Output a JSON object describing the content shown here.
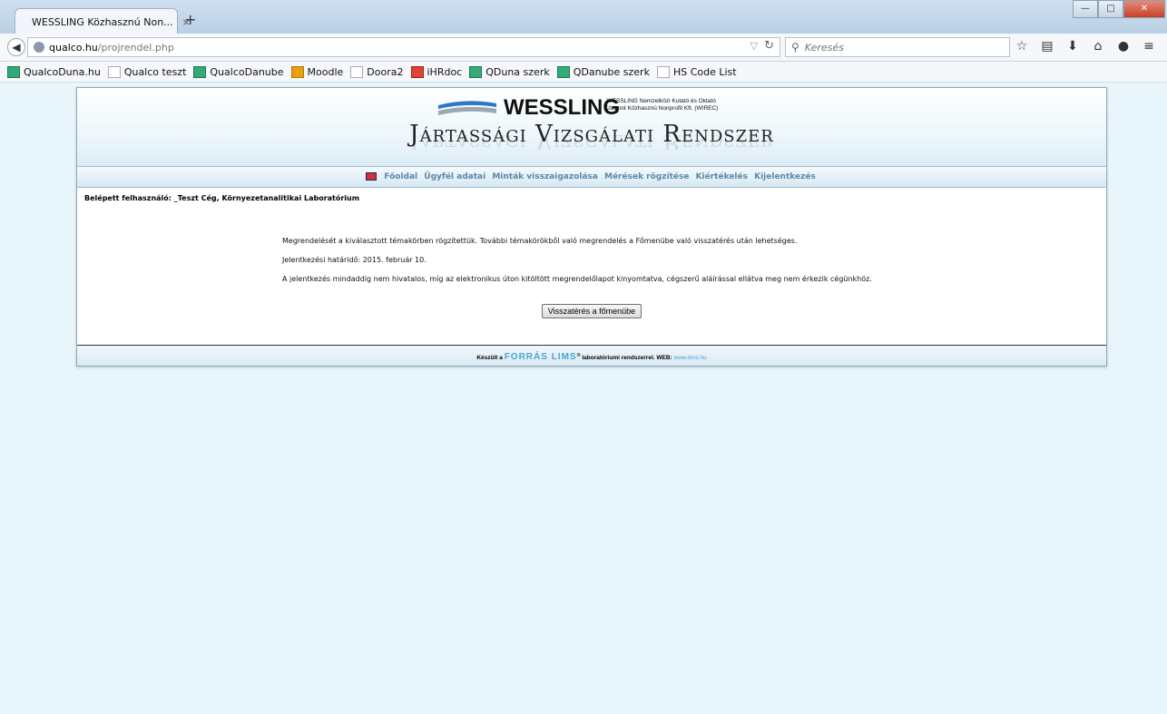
{
  "browser": {
    "tab_title": "WESSLING Közhasznú Non...",
    "tab_close": "×",
    "new_tab": "+",
    "url_host": "qualco.hu",
    "url_path": "/projrendel.php",
    "search_placeholder": "Keresés",
    "bookmarks": [
      "QualcoDuna.hu",
      "Qualco teszt",
      "QualcoDanube",
      "Moodle",
      "Doora2",
      "iHRdoc",
      "QDuna szerk",
      "QDanube szerk",
      "HS Code List"
    ]
  },
  "header": {
    "brand": "WESSLING",
    "org_line1": "WESSLING Nemzetközi Kutató és Oktató",
    "org_line2": "Központ Közhasznú Nonprofit Kft. (WIREC)",
    "system_title": "Jártassági Vizsgálati Rendszer"
  },
  "menu": {
    "items": [
      "Főoldal",
      "Ügyfél adatai",
      "Minták visszaigazolása",
      "Mérések rögzítése",
      "Kiértékelés",
      "Kijelentkezés"
    ]
  },
  "user": {
    "line": "Belépett felhasználó: _Teszt Cég, Környezetanalitikai Laboratórium"
  },
  "content": {
    "p1": "Megrendelését a kiválasztott témakörben rögzítettük. További témakörökből való megrendelés a Főmenübe való visszatérés után lehetséges.",
    "p2": "Jelentkezési határidő: 2015. február 10.",
    "p3": "A jelentkezés mindaddig nem hivatalos, míg az elektronikus úton kitöltött megrendelőlapot kinyomtatva, cégszerű aláírással ellátva meg nem érkezik cégünkhöz.",
    "button": "Visszatérés a főmenübe"
  },
  "footer": {
    "pre": "Készült a",
    "lims": "FORRÁS LIMS",
    "sup": "®",
    "post": "laboratóriumi rendszerrel.",
    "web_label": "WEB:",
    "web_url": "www.lims.hu"
  }
}
